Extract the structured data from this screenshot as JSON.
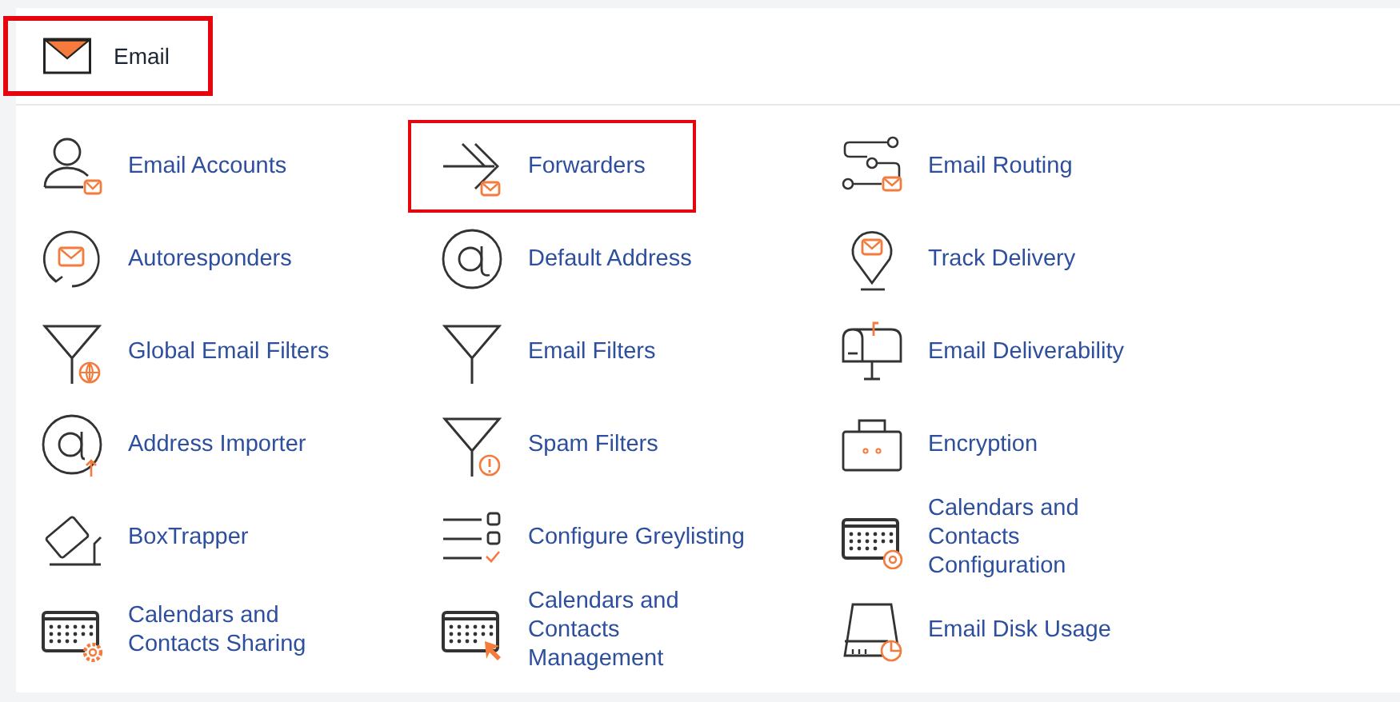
{
  "section": {
    "title": "Email",
    "highlighted": true
  },
  "items": [
    {
      "label": "Email Accounts",
      "highlighted": false
    },
    {
      "label": "Forwarders",
      "highlighted": true
    },
    {
      "label": "Email Routing",
      "highlighted": false
    },
    {
      "label": "Autoresponders",
      "highlighted": false
    },
    {
      "label": "Default Address",
      "highlighted": false
    },
    {
      "label": "Track Delivery",
      "highlighted": false
    },
    {
      "label": "Global Email Filters",
      "highlighted": false
    },
    {
      "label": "Email Filters",
      "highlighted": false
    },
    {
      "label": "Email Deliverability",
      "highlighted": false
    },
    {
      "label": "Address Importer",
      "highlighted": false
    },
    {
      "label": "Spam Filters",
      "highlighted": false
    },
    {
      "label": "Encryption",
      "highlighted": false
    },
    {
      "label": "BoxTrapper",
      "highlighted": false
    },
    {
      "label": "Configure Greylisting",
      "highlighted": false
    },
    {
      "label": "Calendars and Contacts Configuration",
      "highlighted": false
    },
    {
      "label": "Calendars and Contacts Sharing",
      "highlighted": false
    },
    {
      "label": "Calendars and Contacts Management",
      "highlighted": false
    },
    {
      "label": "Email Disk Usage",
      "highlighted": false
    }
  ]
}
